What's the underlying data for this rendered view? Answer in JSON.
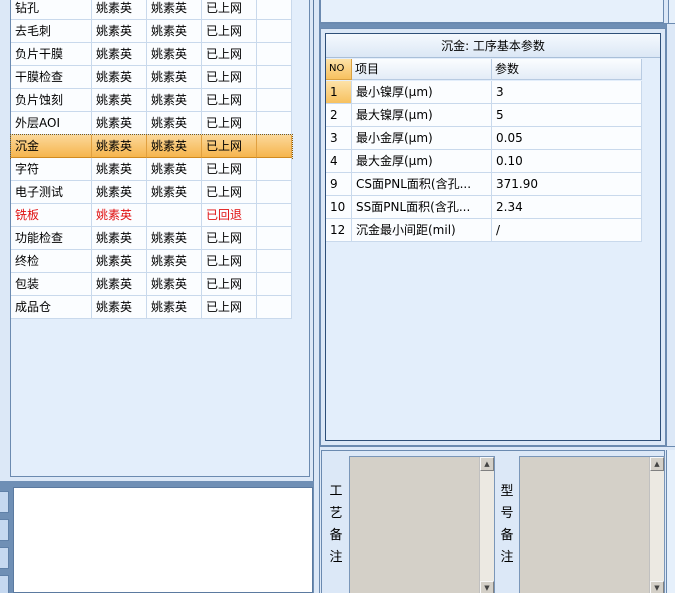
{
  "process_grid": {
    "rows": [
      {
        "name": "钻孔",
        "col2": "姚素英",
        "col3": "姚素英",
        "status": "已上网",
        "state": "normal"
      },
      {
        "name": "去毛刺",
        "col2": "姚素英",
        "col3": "姚素英",
        "status": "已上网",
        "state": "normal"
      },
      {
        "name": "负片干膜",
        "col2": "姚素英",
        "col3": "姚素英",
        "status": "已上网",
        "state": "normal"
      },
      {
        "name": "干膜检查",
        "col2": "姚素英",
        "col3": "姚素英",
        "status": "已上网",
        "state": "normal"
      },
      {
        "name": "负片蚀刻",
        "col2": "姚素英",
        "col3": "姚素英",
        "status": "已上网",
        "state": "normal"
      },
      {
        "name": "外层AOI",
        "col2": "姚素英",
        "col3": "姚素英",
        "status": "已上网",
        "state": "normal"
      },
      {
        "name": "沉金",
        "col2": "姚素英",
        "col3": "姚素英",
        "status": "已上网",
        "state": "selected"
      },
      {
        "name": "字符",
        "col2": "姚素英",
        "col3": "姚素英",
        "status": "已上网",
        "state": "normal"
      },
      {
        "name": "电子测试",
        "col2": "姚素英",
        "col3": "姚素英",
        "status": "已上网",
        "state": "normal"
      },
      {
        "name": "铣板",
        "col2": "姚素英",
        "col3": "",
        "status": "已回退",
        "state": "returned"
      },
      {
        "name": "功能检查",
        "col2": "姚素英",
        "col3": "姚素英",
        "status": "已上网",
        "state": "normal"
      },
      {
        "name": "终检",
        "col2": "姚素英",
        "col3": "姚素英",
        "status": "已上网",
        "state": "normal"
      },
      {
        "name": "包装",
        "col2": "姚素英",
        "col3": "姚素英",
        "status": "已上网",
        "state": "normal"
      },
      {
        "name": "成品仓",
        "col2": "姚素英",
        "col3": "姚素英",
        "status": "已上网",
        "state": "normal"
      }
    ]
  },
  "params": {
    "title": "沉金: 工序基本参数",
    "headers": {
      "no": "NO",
      "item": "项目",
      "value": "参数"
    },
    "rows": [
      {
        "no": "1",
        "item": "最小镍厚(μm)",
        "value": "3"
      },
      {
        "no": "2",
        "item": "最大镍厚(μm)",
        "value": "5"
      },
      {
        "no": "3",
        "item": "最小金厚(μm)",
        "value": "0.05"
      },
      {
        "no": "4",
        "item": "最大金厚(μm)",
        "value": "0.10"
      },
      {
        "no": "9",
        "item": "CS面PNL面积(含孔...",
        "value": "371.90"
      },
      {
        "no": "10",
        "item": "SS面PNL面积(含孔...",
        "value": "2.34"
      },
      {
        "no": "12",
        "item": "沉金最小间距(mil)",
        "value": "/"
      }
    ]
  },
  "memos": {
    "process_memo_label": [
      "工",
      "艺",
      "备",
      "注"
    ],
    "model_memo_label": [
      "型",
      "号",
      "备",
      "注"
    ]
  },
  "colors": {
    "selected_row": "#f6b54d",
    "returned_text": "#e01010",
    "panel_bg": "#dce8f7"
  }
}
